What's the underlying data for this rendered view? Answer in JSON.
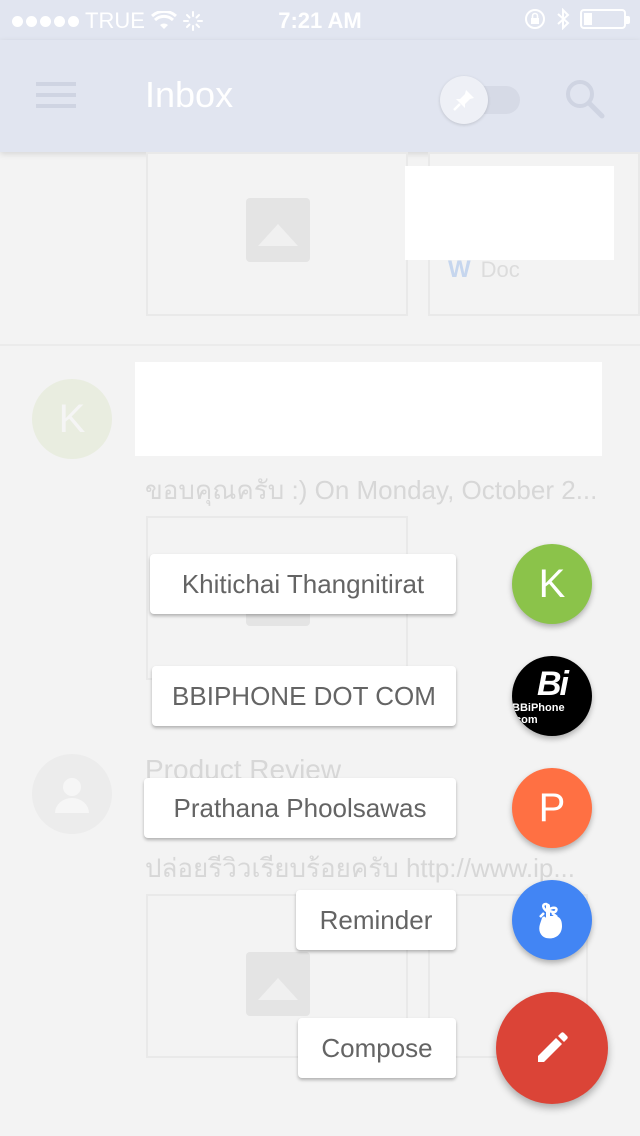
{
  "status_bar": {
    "carrier": "TRUE",
    "time": "7:21 AM",
    "signal_dots": 5,
    "battery_level": 0.2
  },
  "app_bar": {
    "title": "Inbox",
    "menu_icon": "hamburger-menu-icon",
    "pin_icon": "pin-icon",
    "search_icon": "search-icon",
    "pin_toggle_on": false
  },
  "background_list": {
    "attachment_doc_label": "Doc",
    "attachment_doc_glyph": "W",
    "item1": {
      "avatar_letter": "K",
      "avatar_color": "#e9ede0",
      "snippet": "ขอบคุณครับ :) On Monday, October 2..."
    },
    "item2": {
      "subject": "Product Review",
      "snippet": "ปล่อยรีวิวเรียบร้อยครับ http://www.ip..."
    }
  },
  "speed_dial": {
    "items": [
      {
        "label": "Khitichai Thangnitirat",
        "avatar_letter": "K",
        "color": "#8bc34a"
      },
      {
        "label": "BBIPHONE DOT COM",
        "avatar_text": "Bi",
        "avatar_sub": "BBiPhone .com",
        "color": "#000000"
      },
      {
        "label": "Prathana Phoolsawas",
        "avatar_letter": "P",
        "color": "#ff7043"
      },
      {
        "label": "Reminder",
        "icon": "reminder-finger-icon",
        "color": "#4285f4"
      }
    ],
    "compose": {
      "label": "Compose",
      "icon": "pencil-icon",
      "color": "#db4437"
    }
  }
}
